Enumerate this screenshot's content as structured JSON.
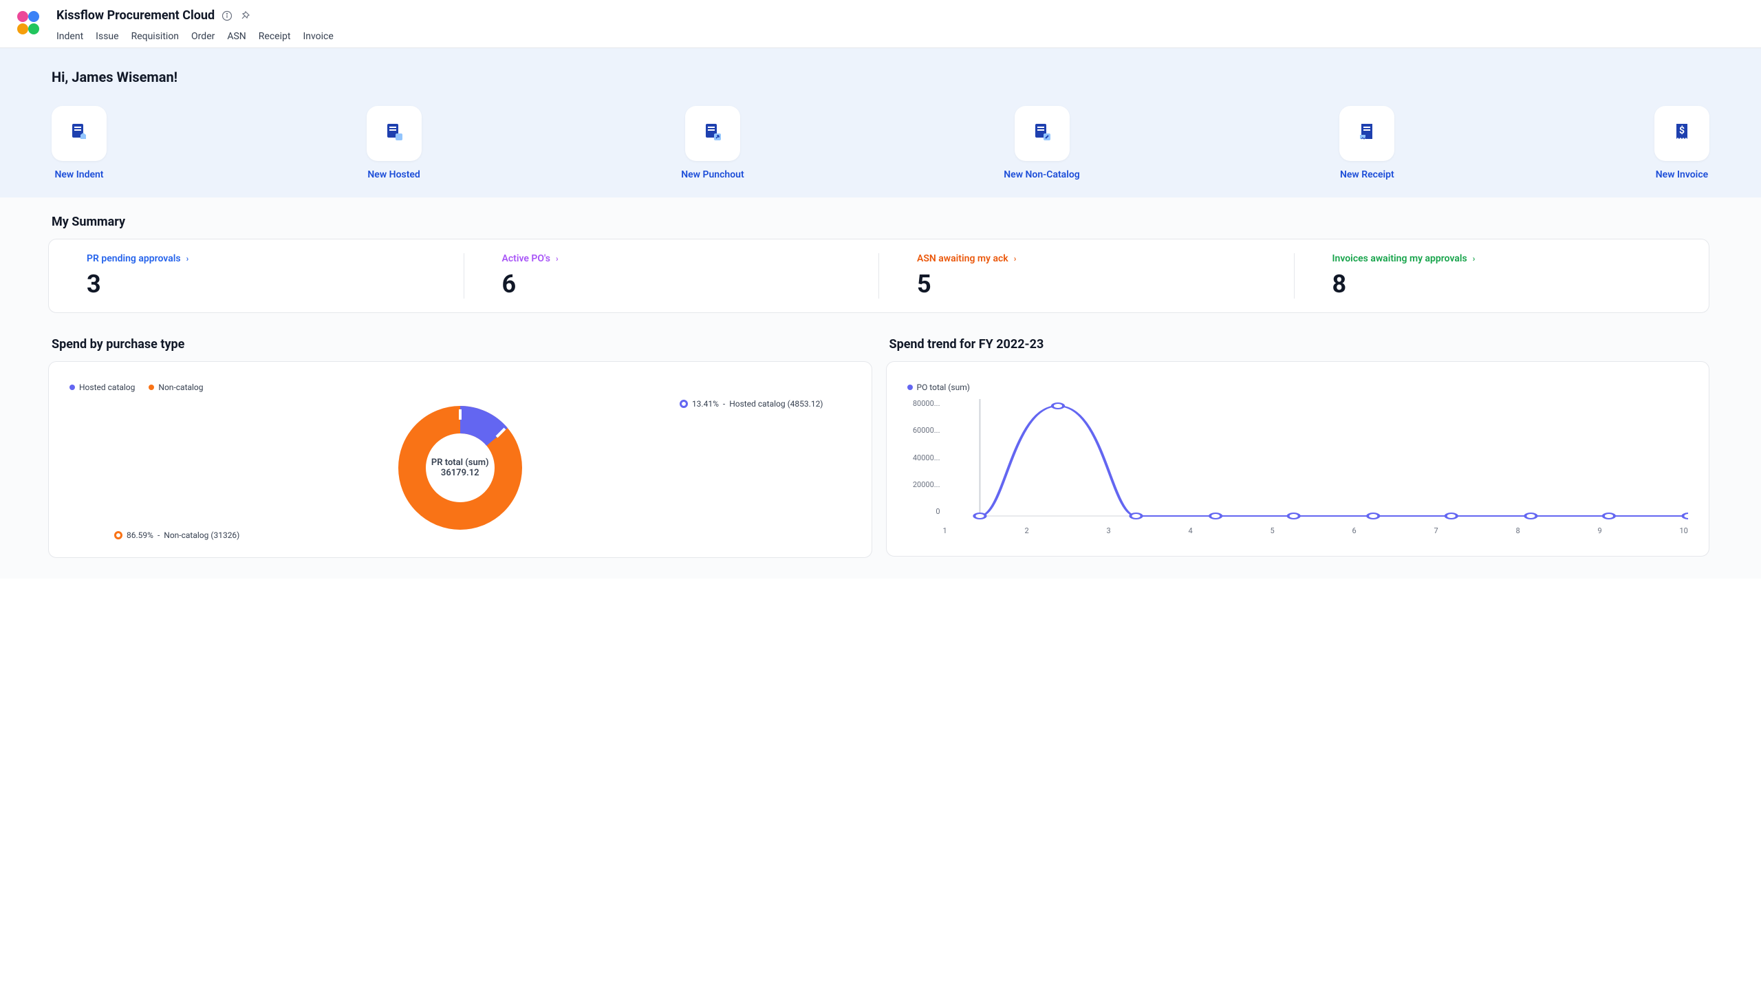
{
  "app_title": "Kissflow Procurement Cloud",
  "tabs": [
    "Indent",
    "Issue",
    "Requisition",
    "Order",
    "ASN",
    "Receipt",
    "Invoice"
  ],
  "greeting": "Hi, James Wiseman!",
  "quick_actions": [
    {
      "label": "New Indent"
    },
    {
      "label": "New Hosted"
    },
    {
      "label": "New Punchout"
    },
    {
      "label": "New Non-Catalog"
    },
    {
      "label": "New Receipt"
    },
    {
      "label": "New Invoice"
    }
  ],
  "my_summary_title": "My Summary",
  "summary": [
    {
      "label": "PR pending approvals",
      "value": "3",
      "color": "#2563eb"
    },
    {
      "label": "Active PO's",
      "value": "6",
      "color": "#a855f7"
    },
    {
      "label": "ASN awaiting my ack",
      "value": "5",
      "color": "#ea580c"
    },
    {
      "label": "Invoices awaiting my approvals",
      "value": "8",
      "color": "#16a34a"
    }
  ],
  "spend_type_title": "Spend by purchase type",
  "spend_trend_title": "Spend trend for FY 2022-23",
  "donut_legend": [
    {
      "label": "Hosted catalog",
      "color": "#6366f1"
    },
    {
      "label": "Non-catalog",
      "color": "#f97316"
    }
  ],
  "donut_center_l1": "PR total (sum)",
  "donut_center_l2": "36179.12",
  "donut_top_percent": "13.41%",
  "donut_top_dash": "-",
  "donut_top_label": "Hosted catalog (4853.12)",
  "donut_bottom_percent": "86.59%",
  "donut_bottom_dash": "-",
  "donut_bottom_label": "Non-catalog (31326)",
  "line_legend": "PO total (sum)",
  "y_ticks": [
    "80000...",
    "60000...",
    "40000...",
    "20000...",
    "0"
  ],
  "x_ticks": [
    "1",
    "2",
    "3",
    "4",
    "5",
    "6",
    "7",
    "8",
    "9",
    "10"
  ],
  "chart_data": [
    {
      "type": "pie",
      "title": "Spend by purchase type",
      "center_label": "PR total (sum) 36179.12",
      "series": [
        {
          "name": "Hosted catalog",
          "value": 4853.12,
          "percent": 13.41,
          "color": "#6366f1"
        },
        {
          "name": "Non-catalog",
          "value": 31326,
          "percent": 86.59,
          "color": "#f97316"
        }
      ]
    },
    {
      "type": "line",
      "title": "Spend trend for FY 2022-23",
      "xlabel": "",
      "ylabel": "",
      "ylim": [
        0,
        80000
      ],
      "x": [
        1,
        2,
        3,
        4,
        5,
        6,
        7,
        8,
        9,
        10
      ],
      "series": [
        {
          "name": "PO total (sum)",
          "color": "#6366f1",
          "values": [
            0,
            78000,
            0,
            0,
            0,
            0,
            0,
            0,
            0,
            0
          ]
        }
      ]
    }
  ]
}
